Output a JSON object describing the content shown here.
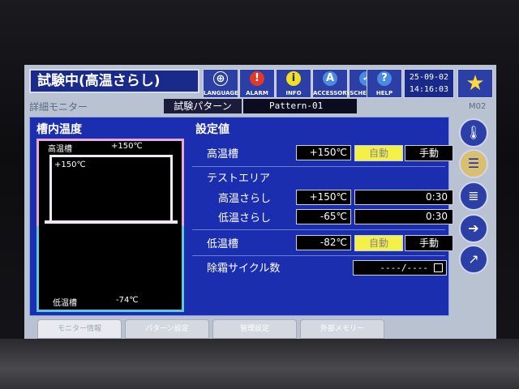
{
  "header": {
    "title": "試験中(高温さらし)",
    "buttons": [
      {
        "label": "LANGUAGE",
        "icon": "globe-icon",
        "glyph": "⊕"
      },
      {
        "label": "ALARM",
        "icon": "alarm-icon",
        "glyph": "!"
      },
      {
        "label": "INFO",
        "icon": "info-icon",
        "glyph": "i"
      },
      {
        "label": "ACCESSORY",
        "icon": "accessory-icon",
        "glyph": "A"
      },
      {
        "label": "SCHEDULE",
        "icon": "schedule-icon",
        "glyph": "✓"
      },
      {
        "label": "HELP",
        "icon": "help-icon",
        "glyph": "?"
      }
    ],
    "date": "25-09-02",
    "time": "14:16:03",
    "favorite_glyph": "★"
  },
  "subheader": {
    "title": "詳細モニター",
    "pattern_label": "試験パターン",
    "pattern_value": "Pattern-01",
    "screen_id": "M02"
  },
  "chamber": {
    "title": "槽内温度",
    "hot_label": "高温槽",
    "hot_temp": "+150℃",
    "test_temp": "+150℃",
    "cold_label": "低温槽",
    "cold_temp": "-74℃"
  },
  "settings": {
    "title": "設定値",
    "hot_tank_label": "高温槽",
    "hot_tank_value": "+150℃",
    "auto_label": "自動",
    "manual_label": "手動",
    "test_area_label": "テストエリア",
    "hot_expose_label": "高温さらし",
    "hot_expose_value": "+150℃",
    "hot_expose_time": "0:30",
    "cold_expose_label": "低温さらし",
    "cold_expose_value": "-65℃",
    "cold_expose_time": "0:30",
    "cold_tank_label": "低温槽",
    "cold_tank_value": "-82℃",
    "defrost_label": "除霜サイクル数",
    "defrost_value": "----/----"
  },
  "side_icons": [
    {
      "name": "thermometer-icon",
      "glyph": "🌡"
    },
    {
      "name": "list-icon",
      "glyph": "☰"
    },
    {
      "name": "stack-icon",
      "glyph": "≣"
    },
    {
      "name": "arrow-right-icon",
      "glyph": "➔"
    },
    {
      "name": "graph-icon",
      "glyph": "↗"
    }
  ],
  "tabs": [
    "モニター情報",
    "パターン設定",
    "管理設定",
    "外部メモリー"
  ],
  "colors": {
    "panel": "#1c2eb0",
    "active_toggle": "#f4f04a",
    "hot_border": "#e8a8d8",
    "cold_border": "#5ec8e0"
  }
}
